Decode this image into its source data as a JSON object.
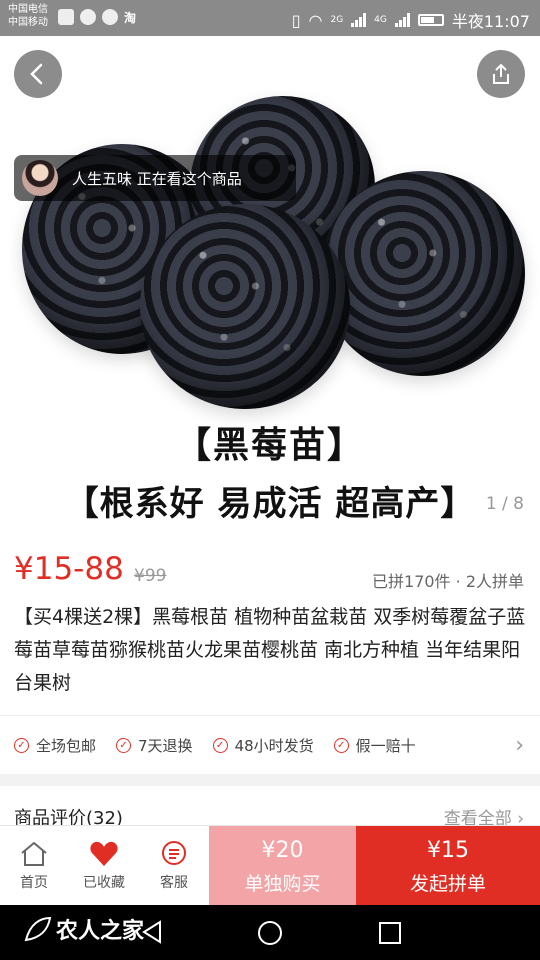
{
  "statusbar": {
    "carrier1": "中国电信",
    "carrier2": "中国移动",
    "app_label": "淘",
    "net1": "2G",
    "net2": "4G",
    "time": "半夜11:07"
  },
  "hero": {
    "viewer_text": "人生五味 正在看这个商品",
    "title_line1": "【黑莓苗】",
    "title_line2": "【根系好 易成活 超高产】",
    "counter": "1 / 8"
  },
  "product": {
    "price": "¥15-88",
    "original_price": "¥99",
    "sold_info": "已拼170件 · 2人拼单",
    "title": "【买4棵送2棵】黑莓根苗 植物种苗盆栽苗 双季树莓覆盆子蓝莓苗草莓苗猕猴桃苗火龙果苗樱桃苗 南北方种植 当年结果阳台果树"
  },
  "guarantees": {
    "items": [
      "全场包邮",
      "7天退换",
      "48小时发货",
      "假一赔十"
    ]
  },
  "reviews": {
    "title": "商品评价(32)",
    "view_all": "查看全部"
  },
  "bottombar": {
    "home": "首页",
    "favorited": "已收藏",
    "service": "客服",
    "solo_price": "¥20",
    "solo_label": "单独购买",
    "group_price": "¥15",
    "group_label": "发起拼单"
  },
  "navbar": {
    "watermark": "农人之家"
  },
  "colors": {
    "accent": "#e02e24",
    "accent_light": "#f3a4a6"
  }
}
